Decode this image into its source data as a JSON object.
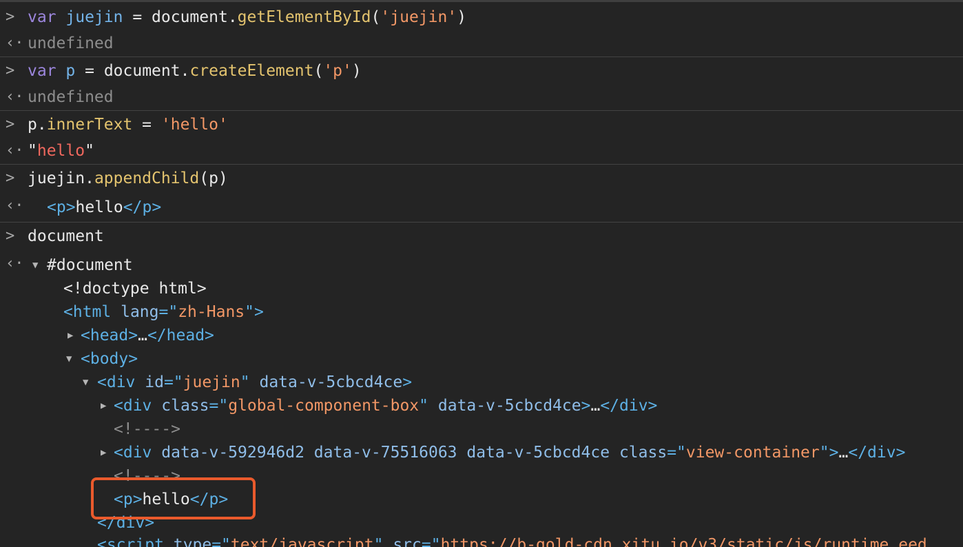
{
  "console": {
    "entries": [
      {
        "input": {
          "kw": "var",
          "name": "juejin",
          "eq": " = ",
          "obj": "document.",
          "fn": "getElementById",
          "open": "(",
          "str": "'juejin'",
          "close": ")"
        },
        "output": "undefined"
      },
      {
        "input": {
          "kw": "var",
          "name": "p",
          "eq": " = ",
          "obj": "document.",
          "fn": "createElement",
          "open": "(",
          "str": "'p'",
          "close": ")"
        },
        "output": "undefined"
      },
      {
        "input": {
          "obj": "p.",
          "prop": "innerText",
          "eq": " = ",
          "str": "'hello'"
        },
        "output": {
          "q1": "\"",
          "val": "hello",
          "q2": "\""
        }
      },
      {
        "input": {
          "obj": "juejin.",
          "fn": "appendChild",
          "args": "(p)"
        },
        "output": {
          "open": "<p>",
          "text": "hello",
          "close": "</p>"
        }
      },
      {
        "input": {
          "text": "document"
        },
        "output": {
          "text": "#document"
        }
      }
    ]
  },
  "tree": {
    "doctype": "<!doctype html>",
    "html_open": "<html",
    "html_attr": "lang",
    "html_eq": "=\"",
    "html_val": "zh-Hans",
    "html_close": "\">",
    "head": "<head>",
    "head_ellipsis": "…",
    "head_close": "</head>",
    "body": "<body>",
    "div_open": "<div",
    "div_id_attr": "id",
    "div_id_eq": "=\"",
    "div_id_val": "juejin",
    "div_id_q": "\"",
    "div_data_attr": "data-v-5cbcd4ce",
    "div_close_bracket": ">",
    "child1_open": "<div",
    "child1_attr": "class",
    "child1_eq": "=\"",
    "child1_val": "global-component-box",
    "child1_q": "\"",
    "child1_data": "data-v-5cbcd4ce",
    "child1_end": ">",
    "child1_ellipsis": "…",
    "child1_close": "</div>",
    "comment1": "<!---->",
    "child2_open": "<div",
    "child2_data": "data-v-592946d2 data-v-75516063 data-v-5cbcd4ce",
    "child2_attr": "class",
    "child2_eq": "=\"",
    "child2_val": "view-container",
    "child2_q": "\"",
    "child2_end": ">",
    "child2_ellipsis": "…",
    "child2_close": "</div>",
    "comment2": "<!---->",
    "p_open": "<p>",
    "p_text": "hello",
    "p_close": "</p>",
    "div_end": "</div>",
    "script_open": "<script",
    "script_type_attr": "type",
    "script_type_eq": "=\"",
    "script_type_val": "text/javascript",
    "script_type_q": "\"",
    "script_src_attr": "src",
    "script_src_eq": "=\"",
    "script_src_val": "https://b-gold-cdn.xitu.io/v3/static/js/runtime.eed"
  },
  "colors": {
    "background": "#242424",
    "highlight_border": "#ea5a2c"
  },
  "icons": {
    "input_prompt": "chevron-right-icon",
    "output_prompt": "return-arrow-icon",
    "expanded": "triangle-down-icon",
    "collapsed": "triangle-right-icon"
  }
}
